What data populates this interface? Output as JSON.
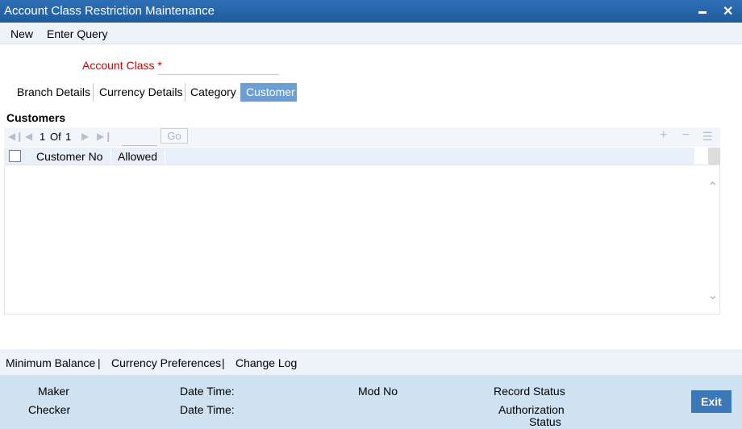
{
  "window": {
    "title": "Account Class Restriction Maintenance",
    "minimize": "▬",
    "close": "✕"
  },
  "menu": {
    "new": "New",
    "enter_query": "Enter Query"
  },
  "form": {
    "account_class_label": "Account Class *",
    "account_class_value": ""
  },
  "tabs": [
    {
      "label": "Branch Details"
    },
    {
      "label": "Currency Details"
    },
    {
      "label": "Category"
    },
    {
      "label": "Customer"
    }
  ],
  "customers": {
    "section_title": "Customers",
    "pager": {
      "current": "1",
      "of": "Of",
      "total": "1",
      "go": "Go"
    },
    "columns": [
      "Customer No",
      "Allowed"
    ],
    "rows": []
  },
  "bottom_links": [
    "Minimum Balance",
    "Currency Preferences",
    "Change Log"
  ],
  "separator": "|",
  "audit": {
    "maker": "Maker",
    "checker": "Checker",
    "date_time": "Date Time:",
    "mod_no": "Mod No",
    "record_status": "Record Status",
    "authorization": "Authorization",
    "status": "Status"
  },
  "exit_label": "Exit",
  "colors": {
    "title_bar": "#1f5c9e",
    "active_tab": "#6a9ed4",
    "footer": "#cfe2f1",
    "exit_button": "#3b78b7",
    "required": "#cc0000"
  }
}
